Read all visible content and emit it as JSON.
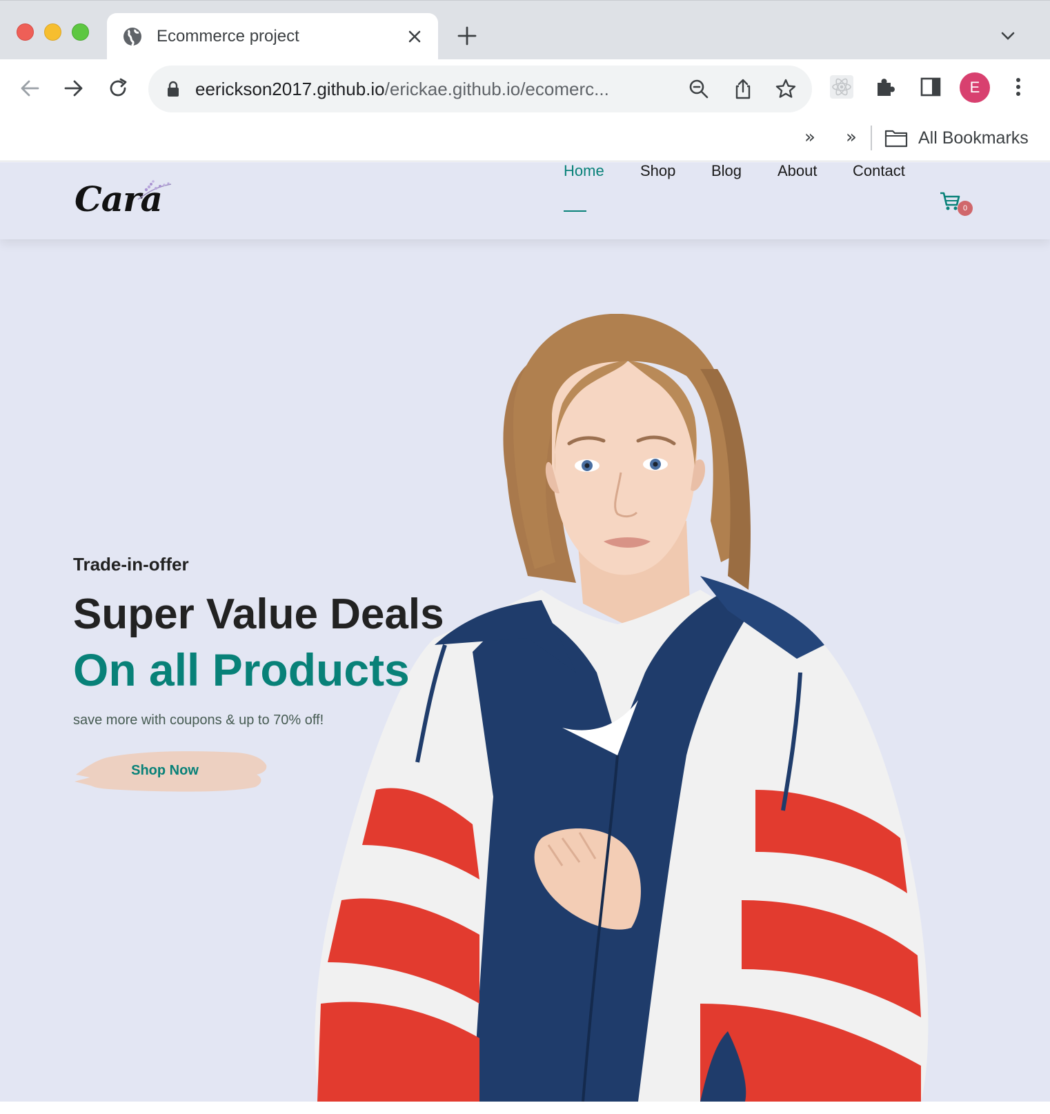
{
  "browser": {
    "tab_title": "Ecommerce project",
    "url_host": "eerickson2017.github.io",
    "url_path": "/erickae.github.io/ecomerc...",
    "avatar_letter": "E",
    "bookmarks_chevron_1": "»",
    "bookmarks_chevron_2": "»",
    "bookmarks_label": "All Bookmarks"
  },
  "site": {
    "logo": "Cara",
    "nav": {
      "home": "Home",
      "shop": "Shop",
      "blog": "Blog",
      "about": "About",
      "contact": "Contact"
    },
    "cart_count": "0",
    "accent_color": "#088178"
  },
  "hero": {
    "kicker": "Trade-in-offer",
    "headline": "Super Value Deals",
    "headline_accent": "On all Products",
    "subtext": "save more with coupons & up to 70% off!",
    "cta_label": "Shop Now"
  }
}
